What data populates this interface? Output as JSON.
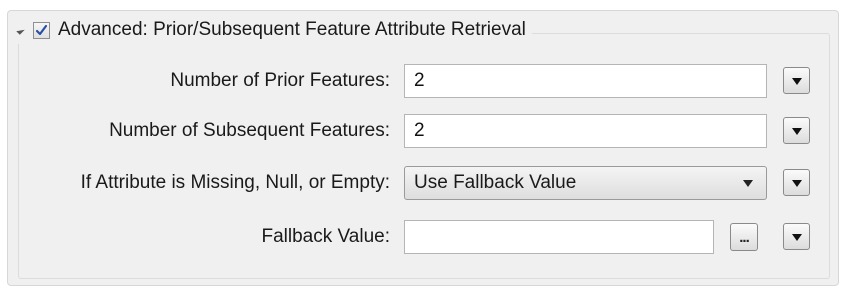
{
  "group": {
    "title": "Advanced: Prior/Subsequent Feature Attribute Retrieval",
    "checked": true,
    "expanded": true
  },
  "fields": {
    "prior": {
      "label": "Number of Prior Features:",
      "value": "2"
    },
    "subsequent": {
      "label": "Number of Subsequent Features:",
      "value": "2"
    },
    "missing": {
      "label": "If Attribute is Missing, Null, or Empty:",
      "value": "Use Fallback Value"
    },
    "fallback": {
      "label": "Fallback Value:",
      "value": "",
      "ellipsis": "..."
    }
  }
}
